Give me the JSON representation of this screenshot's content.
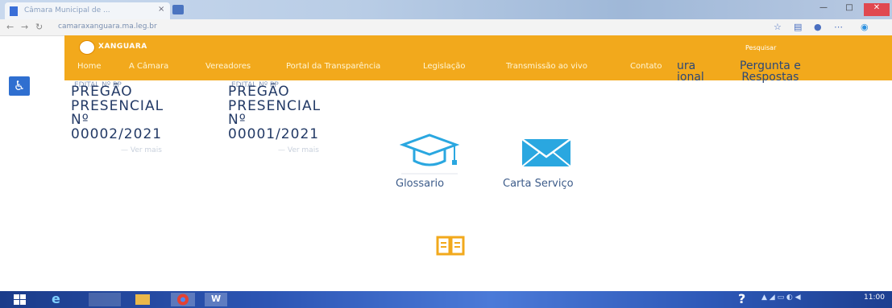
{
  "browser": {
    "tab_title": "Câmara Municipal de ...",
    "tab_close": "×",
    "address": "camaraxanguara.ma.leg.br",
    "nav": {
      "back": "←",
      "forward": "→",
      "refresh": "↻"
    },
    "window": {
      "minimize": "—",
      "maximize": "□",
      "close": "✕"
    }
  },
  "site": {
    "logo_text": "XANGUARA",
    "search_placeholder": "Pesquisar",
    "menu": [
      "Home",
      "A Câmara",
      "Vereadores",
      "Portal da Transparência",
      "Legislação",
      "Transmissão ao vivo",
      "Contato"
    ],
    "accessibility_icon": "♿"
  },
  "cards": {
    "left_title": "PREGÃO\nPRESENCIAL\nNº\n00002/2021",
    "left_header": "EDITAL Nº PP",
    "left_sub": "—   Ver mais",
    "middle_title": "PREGÃO\nPRESENCIAL\nNº\n00001/2021",
    "middle_header": "EDITAL Nº PP",
    "middle_sub": "—   Ver mais",
    "right_partial_1": "ura\nional",
    "right_partial_2": "Pergunta e\nRespostas"
  },
  "links": {
    "glossary": "Glossario",
    "carta_servico": "Carta Serviço"
  },
  "icons": {
    "glossary": "graduation-cap-icon",
    "carta": "envelope-icon",
    "book": "book-icon"
  },
  "colors": {
    "header": "#f2a91c",
    "link_blue": "#2aa7e0",
    "text_navy": "#233a66"
  },
  "taskbar": {
    "help": "?",
    "clock": "11:00"
  }
}
